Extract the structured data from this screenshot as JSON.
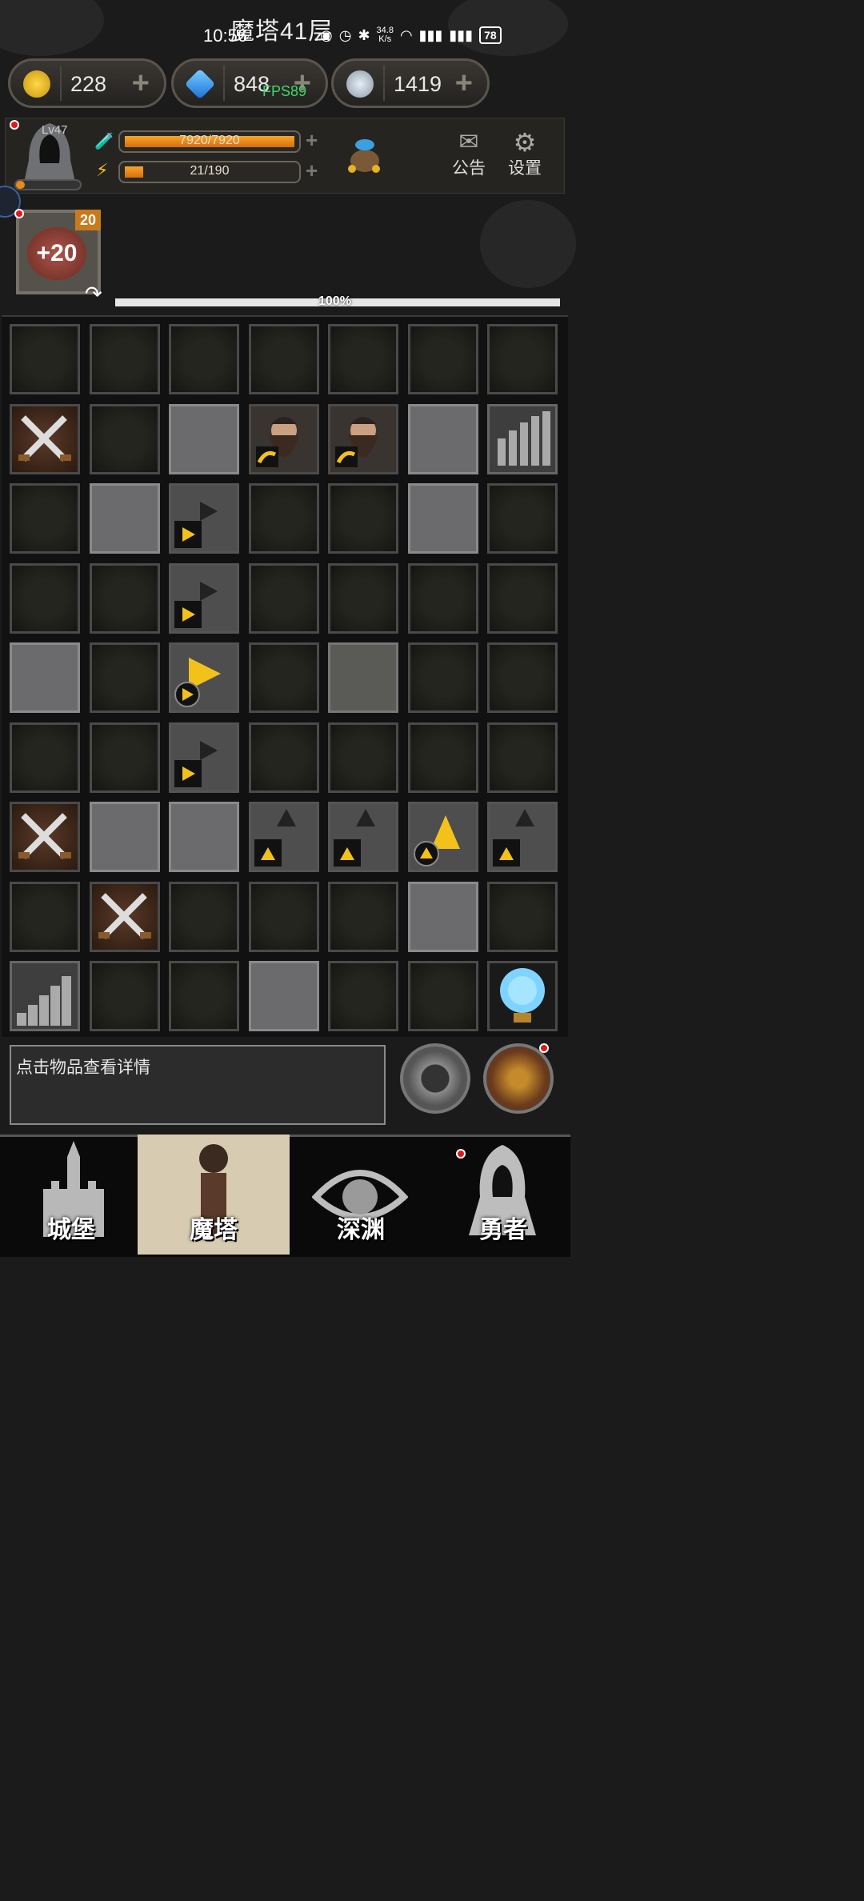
{
  "status_bar": {
    "floor_title": "魔塔41层",
    "time": "10:56",
    "net_speed_value": "34.8",
    "net_speed_unit": "K/s",
    "battery": "78"
  },
  "resources": {
    "gold": "228",
    "gems": "848",
    "keys": "1419",
    "fps": "FPS89"
  },
  "player": {
    "level": "Lv47",
    "exp_fraction": 0.14,
    "hp_text": "7920/7920",
    "hp_fraction": 1.0,
    "energy_text": "21/190",
    "energy_fraction": 0.11,
    "notice_label": "公告",
    "settings_label": "设置"
  },
  "buff": {
    "count": "20",
    "value": "+20"
  },
  "floor_progress": {
    "text": "100%",
    "fraction": 1.0
  },
  "grid": [
    [
      "wall",
      "wall",
      "wall",
      "wall",
      "wall",
      "wall",
      "wall"
    ],
    [
      "sword",
      "wall",
      "floor",
      "dwarf",
      "dwarf",
      "floor",
      "stairs-up"
    ],
    [
      "wall",
      "floor",
      "arrow-right",
      "wall",
      "wall",
      "floor",
      "wall"
    ],
    [
      "wall",
      "wall",
      "arrow-right",
      "wall",
      "wall",
      "wall",
      "wall"
    ],
    [
      "floor",
      "wall",
      "arrow-right-active",
      "wall",
      "floor-dark",
      "wall",
      "wall"
    ],
    [
      "wall",
      "wall",
      "arrow-right",
      "wall",
      "wall",
      "wall",
      "wall"
    ],
    [
      "sword",
      "floor",
      "floor",
      "arrow-up",
      "arrow-up",
      "arrow-up-active",
      "arrow-up"
    ],
    [
      "wall",
      "sword",
      "wall",
      "wall",
      "wall",
      "floor",
      "wall"
    ],
    [
      "stairs-down",
      "wall",
      "wall",
      "floor",
      "wall",
      "wall",
      "orb"
    ]
  ],
  "message": "点击物品查看详情",
  "nav": [
    {
      "label": "城堡",
      "icon": "castle-icon"
    },
    {
      "label": "魔塔",
      "icon": "tower-icon",
      "active": true
    },
    {
      "label": "深渊",
      "icon": "abyss-icon"
    },
    {
      "label": "勇者",
      "icon": "hero-icon"
    }
  ],
  "colors": {
    "accent_orange": "#e88a16",
    "hp_bar": "#f08a1c",
    "fps_green": "#3fd66a",
    "alert_red": "#e01a1a",
    "active_tab": "#d7ccb1"
  }
}
